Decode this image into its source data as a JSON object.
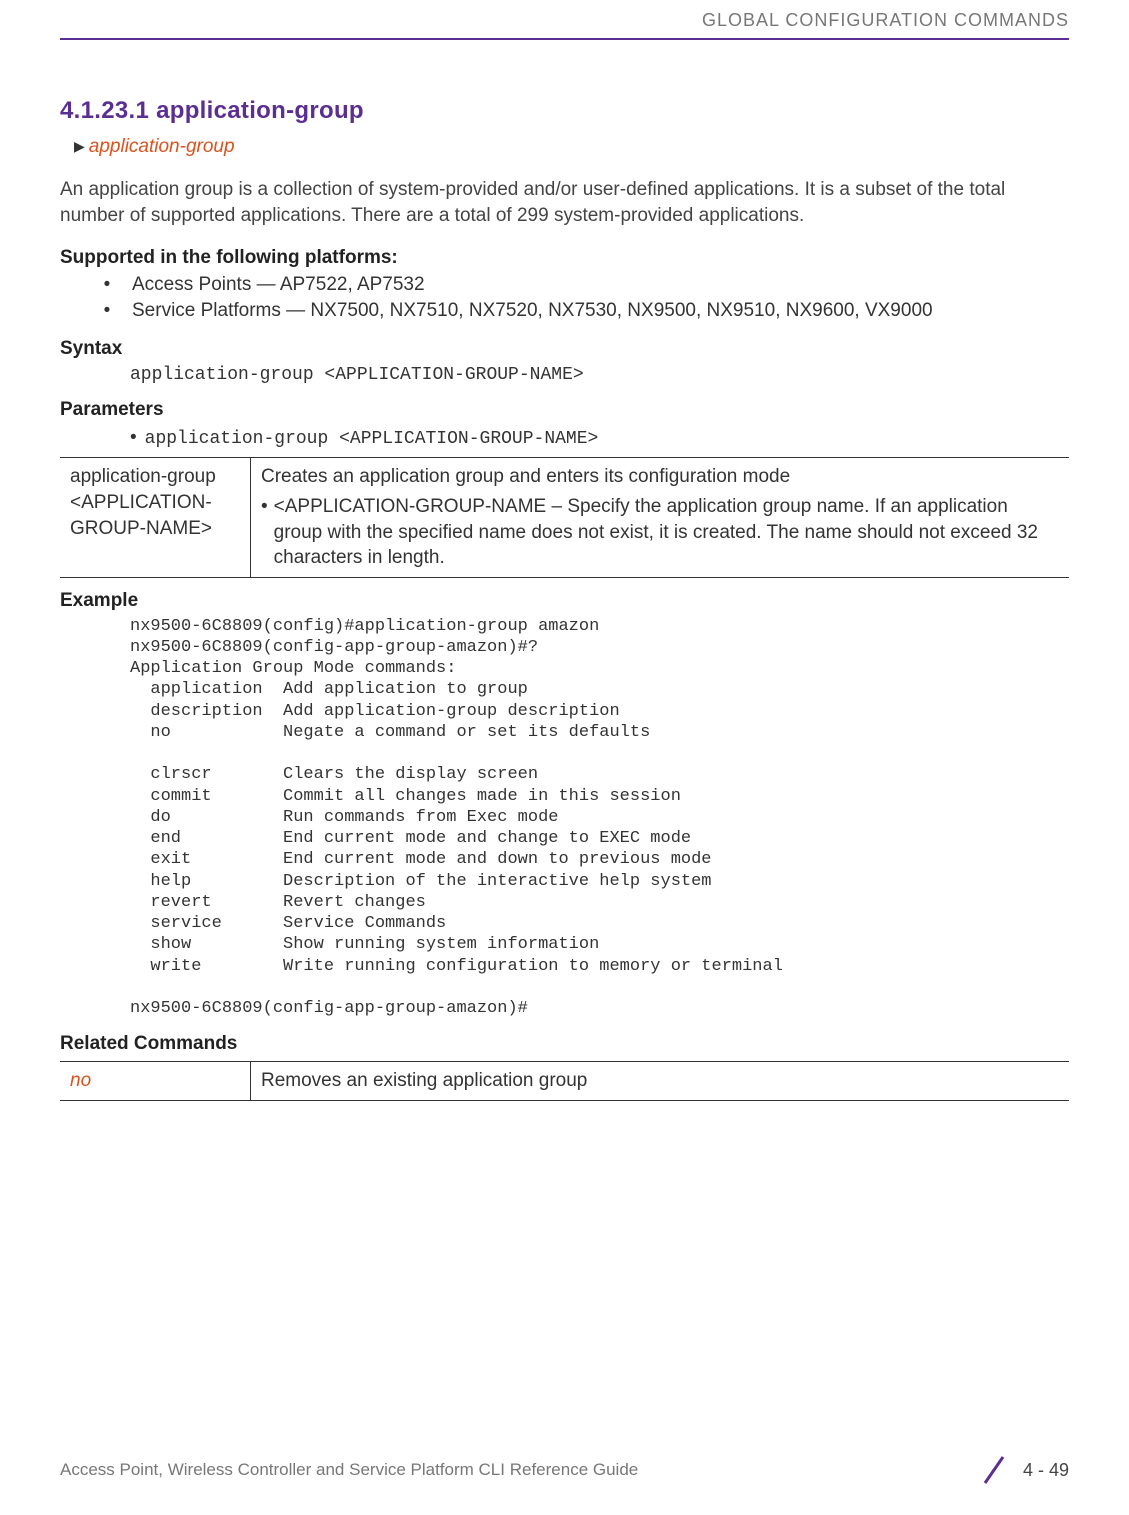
{
  "header": {
    "chapter": "GLOBAL CONFIGURATION COMMANDS"
  },
  "section": {
    "number_title": "4.1.23.1 application-group",
    "breadcrumb": "application-group"
  },
  "intro": "An application group is a collection of system-provided and/or user-defined applications. It is a subset of the total number of supported applications. There are a total of 299 system-provided applications.",
  "supported": {
    "heading": "Supported in the following platforms:",
    "items": [
      "Access Points — AP7522, AP7532",
      "Service Platforms — NX7500, NX7510, NX7520, NX7530, NX9500, NX9510, NX9600, VX9000"
    ]
  },
  "syntax": {
    "heading": "Syntax",
    "line": "application-group <APPLICATION-GROUP-NAME>"
  },
  "parameters": {
    "heading": "Parameters",
    "inline": "application-group <APPLICATION-GROUP-NAME>",
    "table": {
      "left": "application-group <APPLICATION-GROUP-NAME>",
      "right_main": "Creates an application group and enters its configuration mode",
      "right_sub": "<APPLICATION-GROUP-NAME – Specify the application group name. If an application group with the specified name does not exist, it is created. The name should not exceed 32 characters in length."
    }
  },
  "example": {
    "heading": "Example",
    "text": "nx9500-6C8809(config)#application-group amazon\nnx9500-6C8809(config-app-group-amazon)#?\nApplication Group Mode commands:\n  application  Add application to group\n  description  Add application-group description\n  no           Negate a command or set its defaults\n\n  clrscr       Clears the display screen\n  commit       Commit all changes made in this session\n  do           Run commands from Exec mode\n  end          End current mode and change to EXEC mode\n  exit         End current mode and down to previous mode\n  help         Description of the interactive help system\n  revert       Revert changes\n  service      Service Commands\n  show         Show running system information\n  write        Write running configuration to memory or terminal\n\nnx9500-6C8809(config-app-group-amazon)#"
  },
  "related": {
    "heading": "Related Commands",
    "cmd": "no",
    "desc": "Removes an existing application group"
  },
  "footer": {
    "left": "Access Point, Wireless Controller and Service Platform CLI Reference Guide",
    "page": "4 - 49"
  }
}
